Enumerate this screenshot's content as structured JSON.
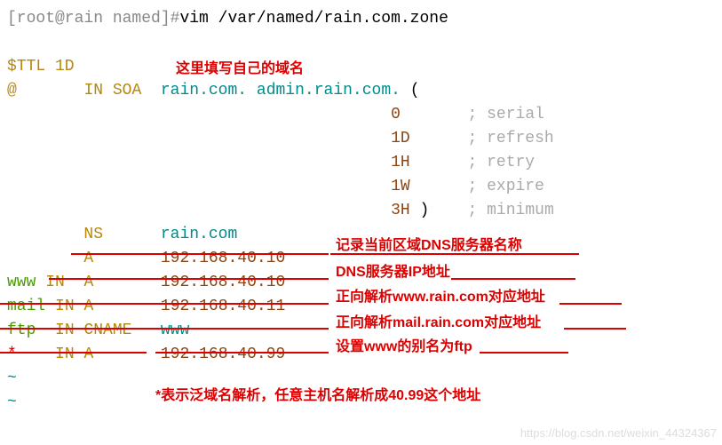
{
  "prompt": {
    "user_host_dir": "[root@rain named]#",
    "command": "vim /var/named/rain.com.zone"
  },
  "zone": {
    "ttl": "$TTL 1D",
    "origin": "@",
    "in": "IN",
    "soa": "SOA",
    "ns": "NS",
    "a": "A",
    "cname": "CNAME",
    "domain": "rain.com.",
    "admin": "admin.rain.com.",
    "open_paren": "(",
    "close_paren": ")",
    "serial_val": "0",
    "serial_comment": "; serial",
    "refresh_val": "1D",
    "refresh_comment": "; refresh",
    "retry_val": "1H",
    "retry_comment": "; retry",
    "expire_val": "1W",
    "expire_comment": "; expire",
    "minimum_val": "3H",
    "minimum_comment": "; minimum",
    "ns_value": "rain.com",
    "a_root_ip": "192.168.40.10",
    "www_host": "www",
    "www_ip": "192.168.40.10",
    "mail_host": "mail",
    "mail_ip": "192.168.40.11",
    "ftp_host": "ftp",
    "ftp_target": "www",
    "wildcard_host": "*",
    "wildcard_ip": "192.168.40.99",
    "tilde": "~"
  },
  "annotations": {
    "domain_note": "这里填写自己的域名",
    "ns_note": "记录当前区域DNS服务器名称",
    "a_root_note": "DNS服务器IP地址",
    "www_note": "正向解析www.rain.com对应地址",
    "mail_note": "正向解析mail.rain.com对应地址",
    "ftp_note": "设置www的别名为ftp",
    "wildcard_note": "*表示泛域名解析，任意主机名解析成40.99这个地址"
  },
  "watermark": "https://blog.csdn.net/weixin_44324367"
}
